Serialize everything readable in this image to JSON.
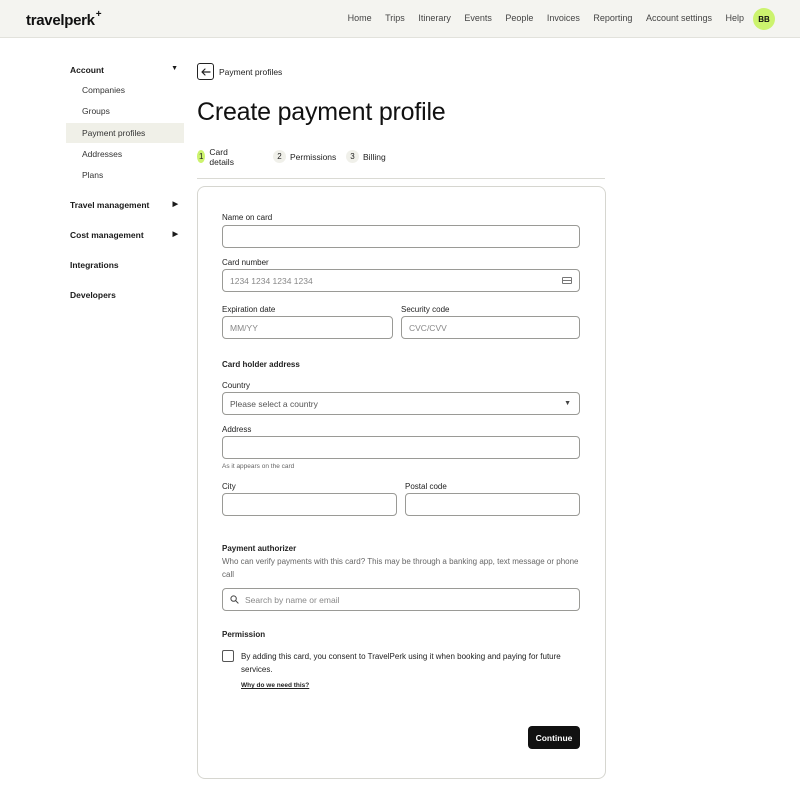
{
  "header": {
    "logo_text": "travelperk",
    "logo_mark": "+",
    "nav": [
      "Home",
      "Trips",
      "Itinerary",
      "Events",
      "People",
      "Invoices",
      "Reporting",
      "Account settings",
      "Help"
    ],
    "avatar_initials": "BB",
    "avatar_color": "#ccf36e"
  },
  "sidebar": {
    "account": {
      "label": "Account",
      "arrow": "▼"
    },
    "account_items": [
      "Companies",
      "Groups",
      "Payment profiles",
      "Addresses",
      "Plans"
    ],
    "active_item": "Payment profiles",
    "travel_management": {
      "label": "Travel management",
      "arrow": "▶"
    },
    "cost_management": {
      "label": "Cost management",
      "arrow": "▶"
    },
    "integrations": "Integrations",
    "developers": "Developers"
  },
  "back": {
    "icon": "arrow-left-icon",
    "label": "Payment profiles"
  },
  "page_title": "Create payment profile",
  "steps": [
    {
      "num": "1",
      "label": "Card details",
      "active": true
    },
    {
      "num": "2",
      "label": "Permissions",
      "active": false
    },
    {
      "num": "3",
      "label": "Billing",
      "active": false
    }
  ],
  "form": {
    "name_on_card": {
      "label": "Name on card",
      "value": ""
    },
    "card_number": {
      "label": "Card number",
      "placeholder": "1234 1234 1234 1234",
      "icon": "credit-card-icon"
    },
    "expiration": {
      "label": "Expiration date",
      "placeholder": "MM/YY"
    },
    "security_code": {
      "label": "Security code",
      "placeholder": "CVC/CVV"
    },
    "address_heading": "Card holder address",
    "country": {
      "label": "Country",
      "value": "Please select a country"
    },
    "address": {
      "label": "Address",
      "hint": "As it appears on the card"
    },
    "city": {
      "label": "City"
    },
    "postal_code": {
      "label": "Postal code"
    },
    "authorizer": {
      "label": "Payment authorizer",
      "description": "Who can verify payments with this card? This may be through a banking app, text message or phone call",
      "placeholder": "Search by name or email"
    },
    "permission": {
      "label": "Permission",
      "consent": "By adding this card, you consent to TravelPerk using it when booking and paying for future services.",
      "checked": false,
      "why_link": "Why do we need this?"
    },
    "continue_label": "Continue"
  },
  "colors": {
    "accent": "#ccf36e",
    "button": "#111111",
    "header_bg": "#f4f4f0"
  }
}
